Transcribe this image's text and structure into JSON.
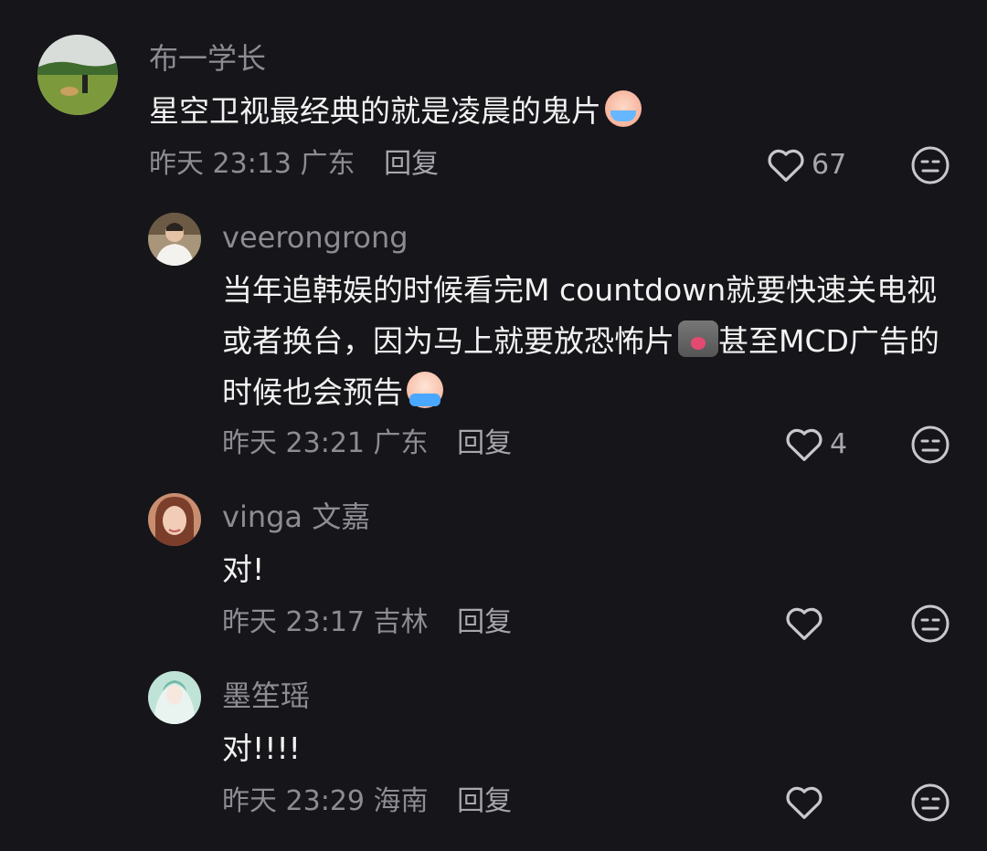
{
  "comments": [
    {
      "username": "布一学长",
      "avatar": "avatar-landscape-dog",
      "text": "星空卫视最经典的就是凌晨的鬼片",
      "emoji": "crying-face-emoji",
      "time": "昨天 23:13",
      "location": "广东",
      "reply_label": "回复",
      "likes": "67"
    },
    {
      "username": "veerongrong",
      "avatar": "avatar-person-white-shirt",
      "text_parts": [
        "当年追韩娱的时候看完M countdown就要快速关电视或者换台，因为马上就要放恐怖片",
        "甚至MCD广告的时候也会预告"
      ],
      "emojis": [
        "screaming-cat-emoji",
        "tearful-face-emoji"
      ],
      "time": "昨天 23:21",
      "location": "广东",
      "reply_label": "回复",
      "likes": "4"
    },
    {
      "username": "vinga 文嘉",
      "avatar": "avatar-woman-portrait",
      "text": "对!",
      "time": "昨天 23:17",
      "location": "吉林",
      "reply_label": "回复",
      "likes": ""
    },
    {
      "username": "墨笙瑶",
      "avatar": "avatar-anime-character",
      "text": "对!!!!",
      "time": "昨天 23:29",
      "location": "海南",
      "reply_label": "回复",
      "likes": ""
    }
  ],
  "colors": {
    "background": "#161519",
    "username": "#8e8c93",
    "text": "#f2f2f2",
    "icon": "#c9c7cc"
  },
  "icons": {
    "like": "heart-outline-icon",
    "dislike": "neutral-face-icon"
  }
}
